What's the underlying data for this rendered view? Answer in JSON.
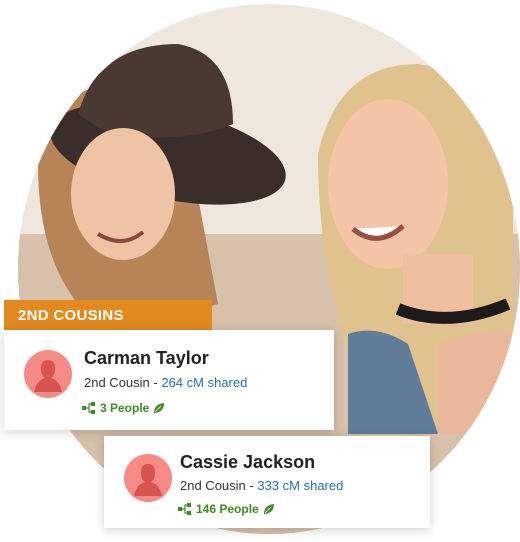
{
  "section": {
    "label": "2ND COUSINS"
  },
  "matches": [
    {
      "name": "Carman Taylor",
      "relationship": "2nd Cousin",
      "separator": " - ",
      "shared": "264 cM shared",
      "people": "3 People"
    },
    {
      "name": "Cassie Jackson",
      "relationship": "2nd Cousin",
      "separator": " - ",
      "shared": "333 cM shared",
      "people": "146 People"
    }
  ],
  "colors": {
    "banner": "#e2891f",
    "avatar": "#f58a86",
    "link": "#2b6fa6",
    "people": "#3f8a26"
  },
  "icons": [
    "person-silhouette-icon",
    "tree-icon",
    "leaf-icon"
  ]
}
